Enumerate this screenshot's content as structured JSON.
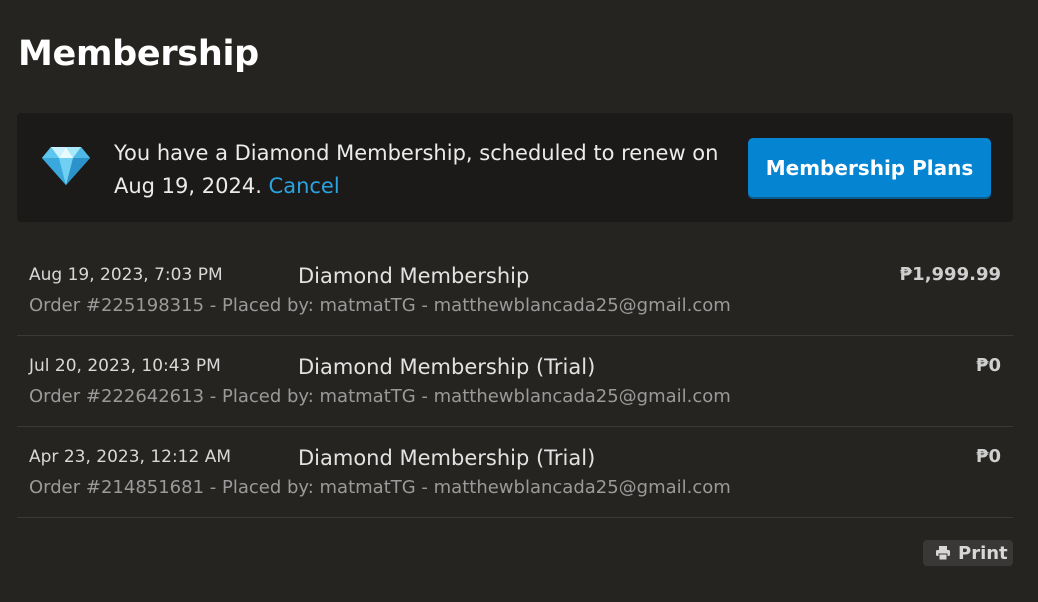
{
  "page": {
    "title": "Membership"
  },
  "banner": {
    "icon": "diamond-icon",
    "message": "You have a Diamond Membership, scheduled to renew on Aug 19, 2024.",
    "cancel_label": "Cancel",
    "plans_button_label": "Membership Plans"
  },
  "orders": [
    {
      "date": "Aug 19, 2023, 7:03 PM",
      "product": "Diamond Membership",
      "meta": "Order #225198315 - Placed by: matmatTG - matthewblancada25@gmail.com",
      "price": "₱1,999.99"
    },
    {
      "date": "Jul 20, 2023, 10:43 PM",
      "product": "Diamond Membership (Trial)",
      "meta": "Order #222642613 - Placed by: matmatTG - matthewblancada25@gmail.com",
      "price": "₱0"
    },
    {
      "date": "Apr 23, 2023, 12:12 AM",
      "product": "Diamond Membership (Trial)",
      "meta": "Order #214851681 - Placed by: matmatTG - matthewblancada25@gmail.com",
      "price": "₱0"
    }
  ],
  "footer": {
    "print_label": "Print",
    "print_icon": "printer-icon"
  },
  "colors": {
    "background": "#252421",
    "banner_background": "#1b1a19",
    "accent_blue": "#0584d2",
    "link_blue": "#2ba3e0"
  }
}
